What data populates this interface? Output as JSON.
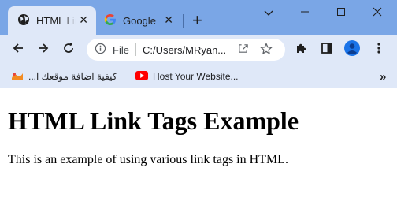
{
  "tabs": [
    {
      "title": "HTML Link Tags Example",
      "close": "✕"
    },
    {
      "title": "Google",
      "close": "✕"
    }
  ],
  "new_tab": "+",
  "omnibox": {
    "scheme_label": "File",
    "url": "C:/Users/MRyan..."
  },
  "bookmarks": [
    {
      "label": "كيفية اضافة موقعك ا..."
    },
    {
      "label": "Host Your Website..."
    }
  ],
  "bookmarks_overflow": "»",
  "page": {
    "heading": "HTML Link Tags Example",
    "paragraph": "This is an example of using various link tags in HTML."
  },
  "colors": {
    "tabbar": "#7aa6e6",
    "toolbar": "#dfe8f8",
    "profile": "#1a73e8"
  }
}
